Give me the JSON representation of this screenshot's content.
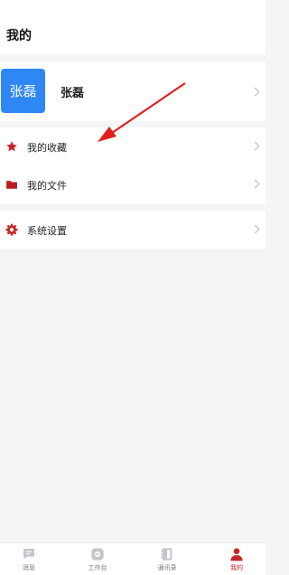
{
  "header": {
    "title": "我的"
  },
  "profile": {
    "avatar_text": "张磊",
    "name": "张磊"
  },
  "menu": [
    {
      "label": "我的收藏",
      "icon": "star-icon"
    },
    {
      "label": "我的文件",
      "icon": "folder-icon"
    }
  ],
  "settings": {
    "label": "系统设置",
    "icon": "gear-icon"
  },
  "tabs": [
    {
      "label": "消息",
      "icon": "message-icon",
      "active": false
    },
    {
      "label": "工作台",
      "icon": "workbench-icon",
      "active": false
    },
    {
      "label": "通讯录",
      "icon": "contacts-icon",
      "active": false
    },
    {
      "label": "我的",
      "icon": "person-icon",
      "active": true
    }
  ],
  "colors": {
    "accent": "#c62828",
    "avatar": "#2f86f5",
    "background": "#f4f5f7"
  }
}
